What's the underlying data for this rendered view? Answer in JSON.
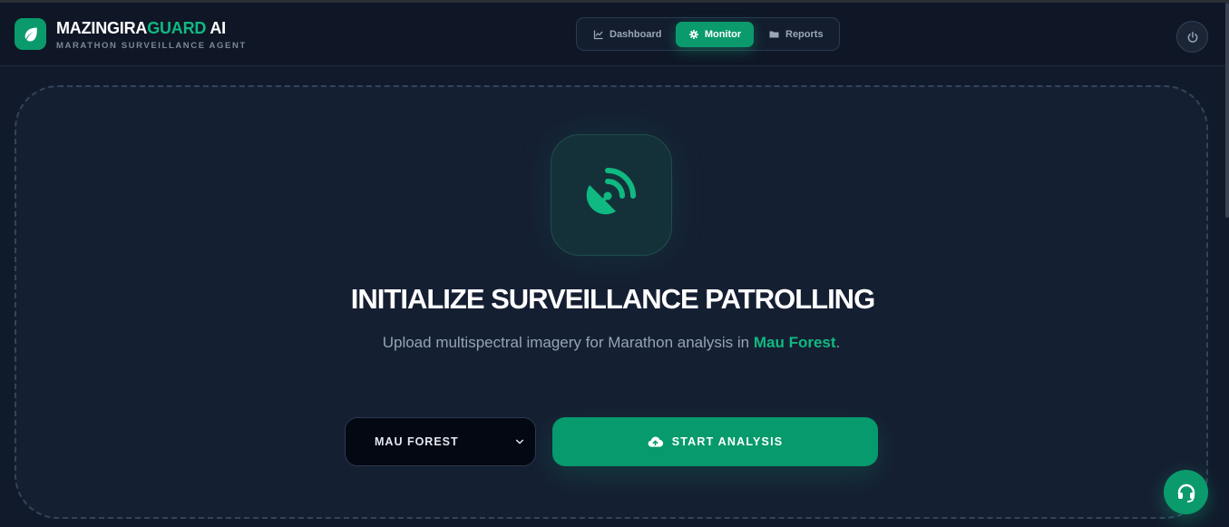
{
  "brand": {
    "name_main": "MAZINGIRA",
    "name_accent": "GUARD",
    "name_suffix": " AI",
    "subtitle": "MARATHON SURVEILLANCE AGENT",
    "logo_icon": "leaf-icon"
  },
  "nav": {
    "items": [
      {
        "label": "Dashboard",
        "icon": "chart-line-icon",
        "active": false
      },
      {
        "label": "Monitor",
        "icon": "gear-icon",
        "active": true
      },
      {
        "label": "Reports",
        "icon": "folder-icon",
        "active": false
      }
    ]
  },
  "header_actions": {
    "power_icon": "power-icon"
  },
  "hero": {
    "icon": "satellite-dish-icon",
    "title": "INITIALIZE SURVEILLANCE PATROLLING",
    "subtitle_prefix": "Upload multispectral imagery for Marathon analysis in ",
    "location": "Mau Forest",
    "subtitle_suffix": "."
  },
  "controls": {
    "region_select": {
      "selected": "MAU FOREST",
      "icon": "chevron-down-icon"
    },
    "start_button": {
      "label": "START ANALYSIS",
      "icon": "cloud-upload-icon"
    }
  },
  "support": {
    "icon": "headset-icon"
  },
  "colors": {
    "accent": "#10b981",
    "button_green": "#079a6c",
    "background": "#111a2b",
    "panel": "#151f32"
  }
}
